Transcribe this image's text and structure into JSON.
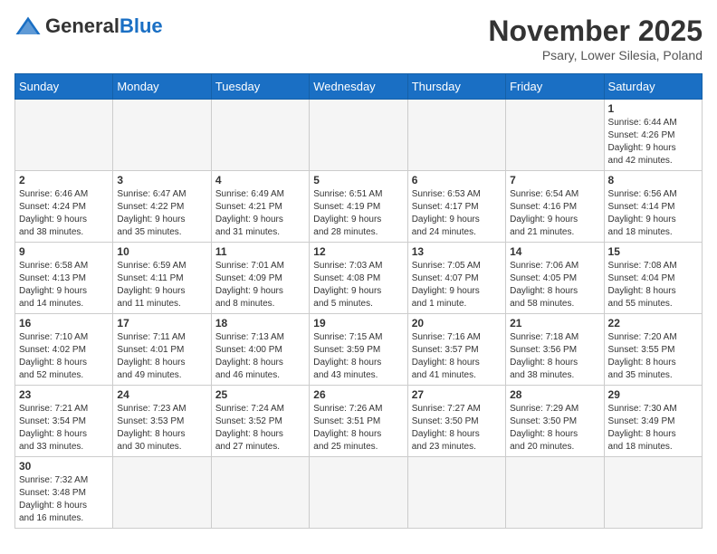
{
  "header": {
    "logo_general": "General",
    "logo_blue": "Blue",
    "month_title": "November 2025",
    "location": "Psary, Lower Silesia, Poland"
  },
  "weekdays": [
    "Sunday",
    "Monday",
    "Tuesday",
    "Wednesday",
    "Thursday",
    "Friday",
    "Saturday"
  ],
  "days": [
    {
      "date": "",
      "info": ""
    },
    {
      "date": "",
      "info": ""
    },
    {
      "date": "",
      "info": ""
    },
    {
      "date": "",
      "info": ""
    },
    {
      "date": "",
      "info": ""
    },
    {
      "date": "",
      "info": ""
    },
    {
      "date": "1",
      "info": "Sunrise: 6:44 AM\nSunset: 4:26 PM\nDaylight: 9 hours\nand 42 minutes."
    },
    {
      "date": "2",
      "info": "Sunrise: 6:46 AM\nSunset: 4:24 PM\nDaylight: 9 hours\nand 38 minutes."
    },
    {
      "date": "3",
      "info": "Sunrise: 6:47 AM\nSunset: 4:22 PM\nDaylight: 9 hours\nand 35 minutes."
    },
    {
      "date": "4",
      "info": "Sunrise: 6:49 AM\nSunset: 4:21 PM\nDaylight: 9 hours\nand 31 minutes."
    },
    {
      "date": "5",
      "info": "Sunrise: 6:51 AM\nSunset: 4:19 PM\nDaylight: 9 hours\nand 28 minutes."
    },
    {
      "date": "6",
      "info": "Sunrise: 6:53 AM\nSunset: 4:17 PM\nDaylight: 9 hours\nand 24 minutes."
    },
    {
      "date": "7",
      "info": "Sunrise: 6:54 AM\nSunset: 4:16 PM\nDaylight: 9 hours\nand 21 minutes."
    },
    {
      "date": "8",
      "info": "Sunrise: 6:56 AM\nSunset: 4:14 PM\nDaylight: 9 hours\nand 18 minutes."
    },
    {
      "date": "9",
      "info": "Sunrise: 6:58 AM\nSunset: 4:13 PM\nDaylight: 9 hours\nand 14 minutes."
    },
    {
      "date": "10",
      "info": "Sunrise: 6:59 AM\nSunset: 4:11 PM\nDaylight: 9 hours\nand 11 minutes."
    },
    {
      "date": "11",
      "info": "Sunrise: 7:01 AM\nSunset: 4:09 PM\nDaylight: 9 hours\nand 8 minutes."
    },
    {
      "date": "12",
      "info": "Sunrise: 7:03 AM\nSunset: 4:08 PM\nDaylight: 9 hours\nand 5 minutes."
    },
    {
      "date": "13",
      "info": "Sunrise: 7:05 AM\nSunset: 4:07 PM\nDaylight: 9 hours\nand 1 minute."
    },
    {
      "date": "14",
      "info": "Sunrise: 7:06 AM\nSunset: 4:05 PM\nDaylight: 8 hours\nand 58 minutes."
    },
    {
      "date": "15",
      "info": "Sunrise: 7:08 AM\nSunset: 4:04 PM\nDaylight: 8 hours\nand 55 minutes."
    },
    {
      "date": "16",
      "info": "Sunrise: 7:10 AM\nSunset: 4:02 PM\nDaylight: 8 hours\nand 52 minutes."
    },
    {
      "date": "17",
      "info": "Sunrise: 7:11 AM\nSunset: 4:01 PM\nDaylight: 8 hours\nand 49 minutes."
    },
    {
      "date": "18",
      "info": "Sunrise: 7:13 AM\nSunset: 4:00 PM\nDaylight: 8 hours\nand 46 minutes."
    },
    {
      "date": "19",
      "info": "Sunrise: 7:15 AM\nSunset: 3:59 PM\nDaylight: 8 hours\nand 43 minutes."
    },
    {
      "date": "20",
      "info": "Sunrise: 7:16 AM\nSunset: 3:57 PM\nDaylight: 8 hours\nand 41 minutes."
    },
    {
      "date": "21",
      "info": "Sunrise: 7:18 AM\nSunset: 3:56 PM\nDaylight: 8 hours\nand 38 minutes."
    },
    {
      "date": "22",
      "info": "Sunrise: 7:20 AM\nSunset: 3:55 PM\nDaylight: 8 hours\nand 35 minutes."
    },
    {
      "date": "23",
      "info": "Sunrise: 7:21 AM\nSunset: 3:54 PM\nDaylight: 8 hours\nand 33 minutes."
    },
    {
      "date": "24",
      "info": "Sunrise: 7:23 AM\nSunset: 3:53 PM\nDaylight: 8 hours\nand 30 minutes."
    },
    {
      "date": "25",
      "info": "Sunrise: 7:24 AM\nSunset: 3:52 PM\nDaylight: 8 hours\nand 27 minutes."
    },
    {
      "date": "26",
      "info": "Sunrise: 7:26 AM\nSunset: 3:51 PM\nDaylight: 8 hours\nand 25 minutes."
    },
    {
      "date": "27",
      "info": "Sunrise: 7:27 AM\nSunset: 3:50 PM\nDaylight: 8 hours\nand 23 minutes."
    },
    {
      "date": "28",
      "info": "Sunrise: 7:29 AM\nSunset: 3:50 PM\nDaylight: 8 hours\nand 20 minutes."
    },
    {
      "date": "29",
      "info": "Sunrise: 7:30 AM\nSunset: 3:49 PM\nDaylight: 8 hours\nand 18 minutes."
    },
    {
      "date": "30",
      "info": "Sunrise: 7:32 AM\nSunset: 3:48 PM\nDaylight: 8 hours\nand 16 minutes."
    },
    {
      "date": "",
      "info": ""
    },
    {
      "date": "",
      "info": ""
    },
    {
      "date": "",
      "info": ""
    },
    {
      "date": "",
      "info": ""
    },
    {
      "date": "",
      "info": ""
    },
    {
      "date": "",
      "info": ""
    }
  ]
}
